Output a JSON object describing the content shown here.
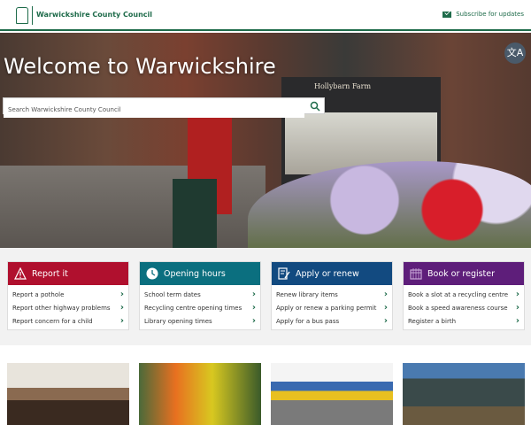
{
  "header": {
    "logo_text": "Warwickshire County Council",
    "subscribe": "Subscribe for updates"
  },
  "hero": {
    "title": "Welcome to Warwickshire",
    "search_placeholder": "Search Warwickshire County Council",
    "shop_sign": "Hollybarn Farm",
    "translate_icon": "文A"
  },
  "cards": [
    {
      "title": "Report it",
      "color": "#b0102e",
      "icon": "warning-icon",
      "links": [
        "Report a pothole",
        "Report other highway problems",
        "Report concern for a child"
      ]
    },
    {
      "title": "Opening hours",
      "color": "#0b6f7f",
      "icon": "clock-icon",
      "links": [
        "School term dates",
        "Recycling centre opening times",
        "Library opening times"
      ]
    },
    {
      "title": "Apply or renew",
      "color": "#124a80",
      "icon": "form-icon",
      "links": [
        "Renew library items",
        "Apply or renew a parking permit",
        "Apply for a bus pass"
      ]
    },
    {
      "title": "Book or register",
      "color": "#5e1e7a",
      "icon": "calendar-icon",
      "links": [
        "Book a slot at a recycling centre",
        "Book a speed awareness course",
        "Register a birth"
      ]
    }
  ]
}
